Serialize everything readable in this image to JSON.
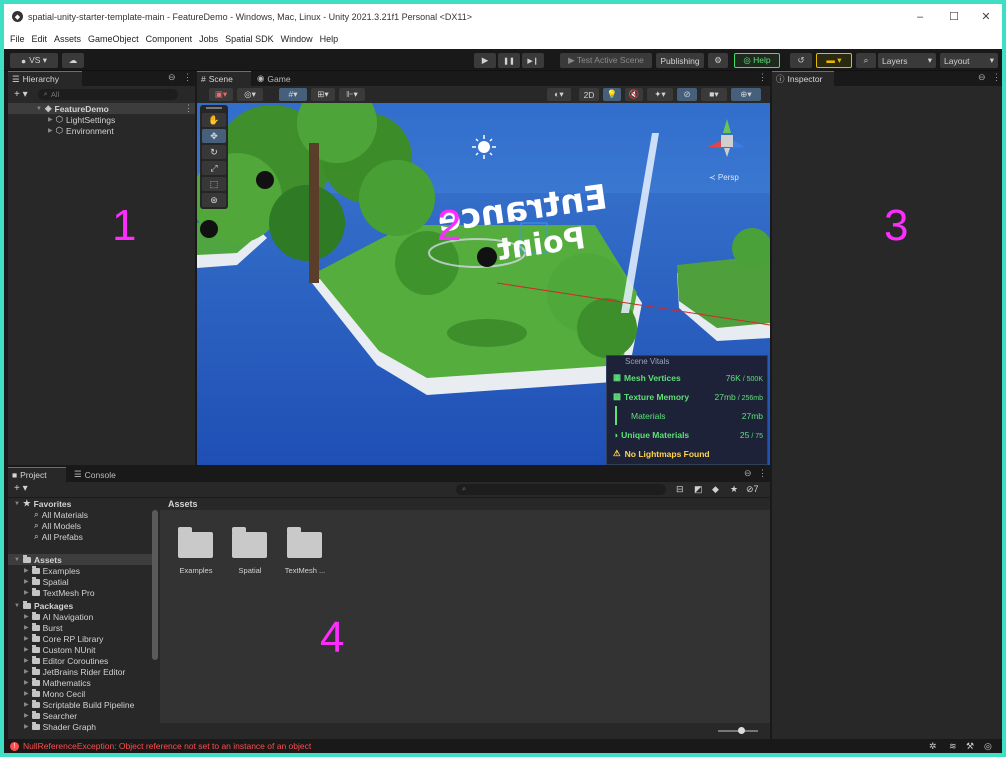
{
  "window": {
    "title": "spatial-unity-starter-template-main - FeatureDemo - Windows, Mac, Linux - Unity 2021.3.21f1 Personal <DX11>",
    "minimize": "–",
    "maximize": "☐",
    "close": "✕"
  },
  "menu": [
    "File",
    "Edit",
    "Assets",
    "GameObject",
    "Component",
    "Jobs",
    "Spatial SDK",
    "Window",
    "Help"
  ],
  "toolbar": {
    "account": "VS ▾",
    "cloud": "☁",
    "play": "▶",
    "pause": "❚❚",
    "step": "▶❙",
    "test_scene": "▶ Test Active Scene",
    "publishing": "Publishing",
    "settings": "⚙",
    "help": "◎ Help",
    "history": "↺",
    "layers_label": "Layers",
    "layout_label": "Layout",
    "search": "⌕"
  },
  "hierarchy": {
    "tab": "Hierarchy",
    "search_placeholder": "All",
    "add": "+ ▾",
    "root": "FeatureDemo",
    "children": [
      "LightSettings",
      "Environment"
    ],
    "region_number": "1"
  },
  "scene": {
    "tab_scene": "Scene",
    "tab_game": "Game",
    "mode_2d": "2D",
    "persp": "≺ Persp",
    "entrance_text_1": "Entrance",
    "entrance_text_2": "Point",
    "region_number": "2",
    "vitals": {
      "title": "Scene Vitals",
      "rows": [
        {
          "label": "Mesh Vertices",
          "value": "76K",
          "limit": " / 500K",
          "color": "#5fe077"
        },
        {
          "label": "Texture Memory",
          "value": "27mb",
          "limit": " / 256mb",
          "color": "#5fe077"
        },
        {
          "label": "Materials",
          "value": "27mb",
          "limit": "",
          "color": "#5fe077"
        },
        {
          "label": "Unique Materials",
          "value": "25",
          "limit": " / 75",
          "color": "#5fe077"
        }
      ],
      "warning": "No Lightmaps Found"
    }
  },
  "inspector": {
    "tab": "Inspector",
    "region_number": "3"
  },
  "project": {
    "tab_project": "Project",
    "tab_console": "Console",
    "add": "+ ▾",
    "favorites_label": "Favorites",
    "favorites": [
      "All Materials",
      "All Models",
      "All Prefabs"
    ],
    "assets_label": "Assets",
    "assets": [
      "Examples",
      "Spatial",
      "TextMesh Pro"
    ],
    "packages_label": "Packages",
    "packages": [
      "AI Navigation",
      "Burst",
      "Core RP Library",
      "Custom NUnit",
      "Editor Coroutines",
      "JetBrains Rider Editor",
      "Mathematics",
      "Mono Cecil",
      "Scriptable Build Pipeline",
      "Searcher",
      "Shader Graph"
    ],
    "breadcrumb": "Assets",
    "grid_items": [
      "Examples",
      "Spatial",
      "TextMesh ..."
    ],
    "hidden_count": "7",
    "region_number": "4"
  },
  "status": {
    "error": "NullReferenceException: Object reference not set to an instance of an object"
  },
  "colors": {
    "accent_green": "#3edfc2",
    "magenta": "#ff2cff",
    "vital_green": "#5fe077",
    "warning_yellow": "#ffd54a",
    "error_red": "#ff4c4c"
  }
}
